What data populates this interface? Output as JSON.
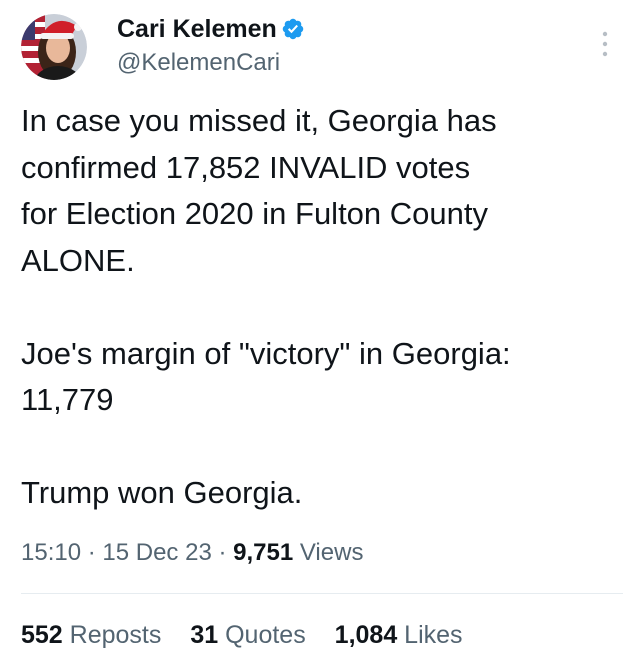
{
  "author": {
    "name": "Cari Kelemen",
    "handle": "@KelemenCari",
    "verified": true
  },
  "tweet": {
    "paragraphs": [
      "In case you missed it, Georgia has\nconfirmed 17,852 INVALID votes\nfor Election 2020 in Fulton County\nALONE.",
      "Joe's margin of \"victory\" in Georgia:\n11,779",
      "Trump won Georgia."
    ]
  },
  "meta": {
    "time": "15:10",
    "separator": " · ",
    "date": "15 Dec 23",
    "views_count": "9,751",
    "views_label": " Views"
  },
  "stats": {
    "reposts_count": "552",
    "reposts_label": " Reposts",
    "quotes_count": "31",
    "quotes_label": " Quotes",
    "likes_count": "1,084",
    "likes_label": " Likes"
  },
  "icons": {
    "avatar": "avatar-image",
    "verified": "verified-badge-icon",
    "more": "more-options-icon"
  },
  "colors": {
    "text_primary": "#0f1419",
    "text_secondary": "#536471",
    "verified_blue": "#1d9bf0",
    "divider": "#e6ecf0"
  }
}
